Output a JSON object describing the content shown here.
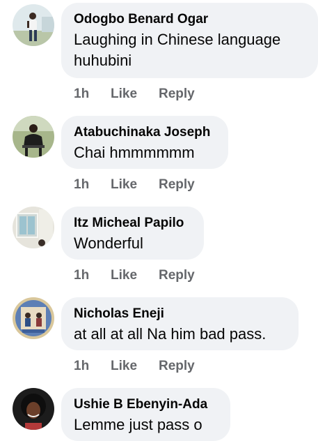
{
  "comments": [
    {
      "author": "Odogbo Benard Ogar",
      "text": "Laughing in Chinese language huhubini",
      "time": "1h",
      "like_label": "Like",
      "reply_label": "Reply",
      "avatar_icon": "person-standing-photo-icon"
    },
    {
      "author": "Atabuchinaka Joseph",
      "text": "Chai hmmmmmm",
      "time": "1h",
      "like_label": "Like",
      "reply_label": "Reply",
      "avatar_icon": "person-seated-photo-icon"
    },
    {
      "author": "Itz Micheal Papilo",
      "text": "Wonderful",
      "time": "1h",
      "like_label": "Like",
      "reply_label": "Reply",
      "avatar_icon": "window-photo-icon"
    },
    {
      "author": "Nicholas Eneji",
      "text": "at all at all Na him bad pass.",
      "time": "1h",
      "like_label": "Like",
      "reply_label": "Reply",
      "avatar_icon": "group-photo-icon"
    },
    {
      "author": "Ushie B Ebenyin-Ada",
      "text": "Lemme just pass o",
      "time": "",
      "like_label": "",
      "reply_label": "",
      "avatar_icon": "woman-portrait-photo-icon"
    }
  ]
}
